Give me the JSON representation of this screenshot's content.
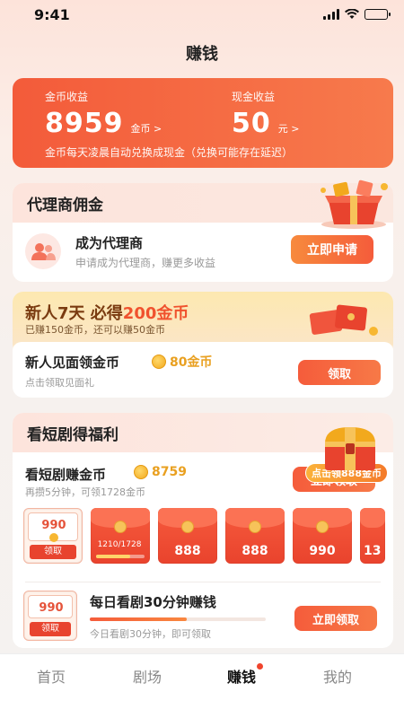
{
  "status": {
    "time": "9:41"
  },
  "page": {
    "title": "赚钱"
  },
  "earnings": {
    "coin_label": "金币收益",
    "coin_value": "8959",
    "coin_unit": "金币 >",
    "cash_label": "现金收益",
    "cash_value": "50",
    "cash_unit": "元 >",
    "note": "金币每天凌晨自动兑换成现金（兑换可能存在延迟）"
  },
  "agent": {
    "section_title": "代理商佣金",
    "title": "成为代理商",
    "subtitle": "申请成为代理商，赚更多收益",
    "button": "立即申请"
  },
  "newbie": {
    "heading_prefix": "新人7天 必得",
    "heading_highlight": "200金币",
    "subtitle": "已赚150金币，还可以赚50金币",
    "title": "新人见面领金币",
    "reward": "80金币",
    "desc": "点击领取见面礼",
    "button": "领取"
  },
  "drama": {
    "section_title": "看短剧得福利",
    "title": "看短剧赚金币",
    "coins": "8759",
    "subtitle": "再攒5分钟，可领1728金币",
    "button": "立即领取",
    "chest_badge": "点击领888金币",
    "packets": [
      {
        "value": "990",
        "button": "领取"
      },
      {
        "progress_text": "1210/1728",
        "progress": 0.7
      },
      {
        "value": "888"
      },
      {
        "value": "888"
      },
      {
        "value": "990"
      },
      {
        "value": "13"
      }
    ],
    "daily": {
      "packet_value": "990",
      "packet_button": "领取",
      "title": "每日看剧30分钟赚钱",
      "progress": 0.55,
      "subtitle": "今日看剧30分钟，即可领取",
      "button": "立即领取"
    }
  },
  "tabs": [
    {
      "label": "首页"
    },
    {
      "label": "剧场"
    },
    {
      "label": "赚钱"
    },
    {
      "label": "我的"
    }
  ],
  "colors": {
    "accent": "#f35b3a",
    "gold": "#e9a020"
  }
}
